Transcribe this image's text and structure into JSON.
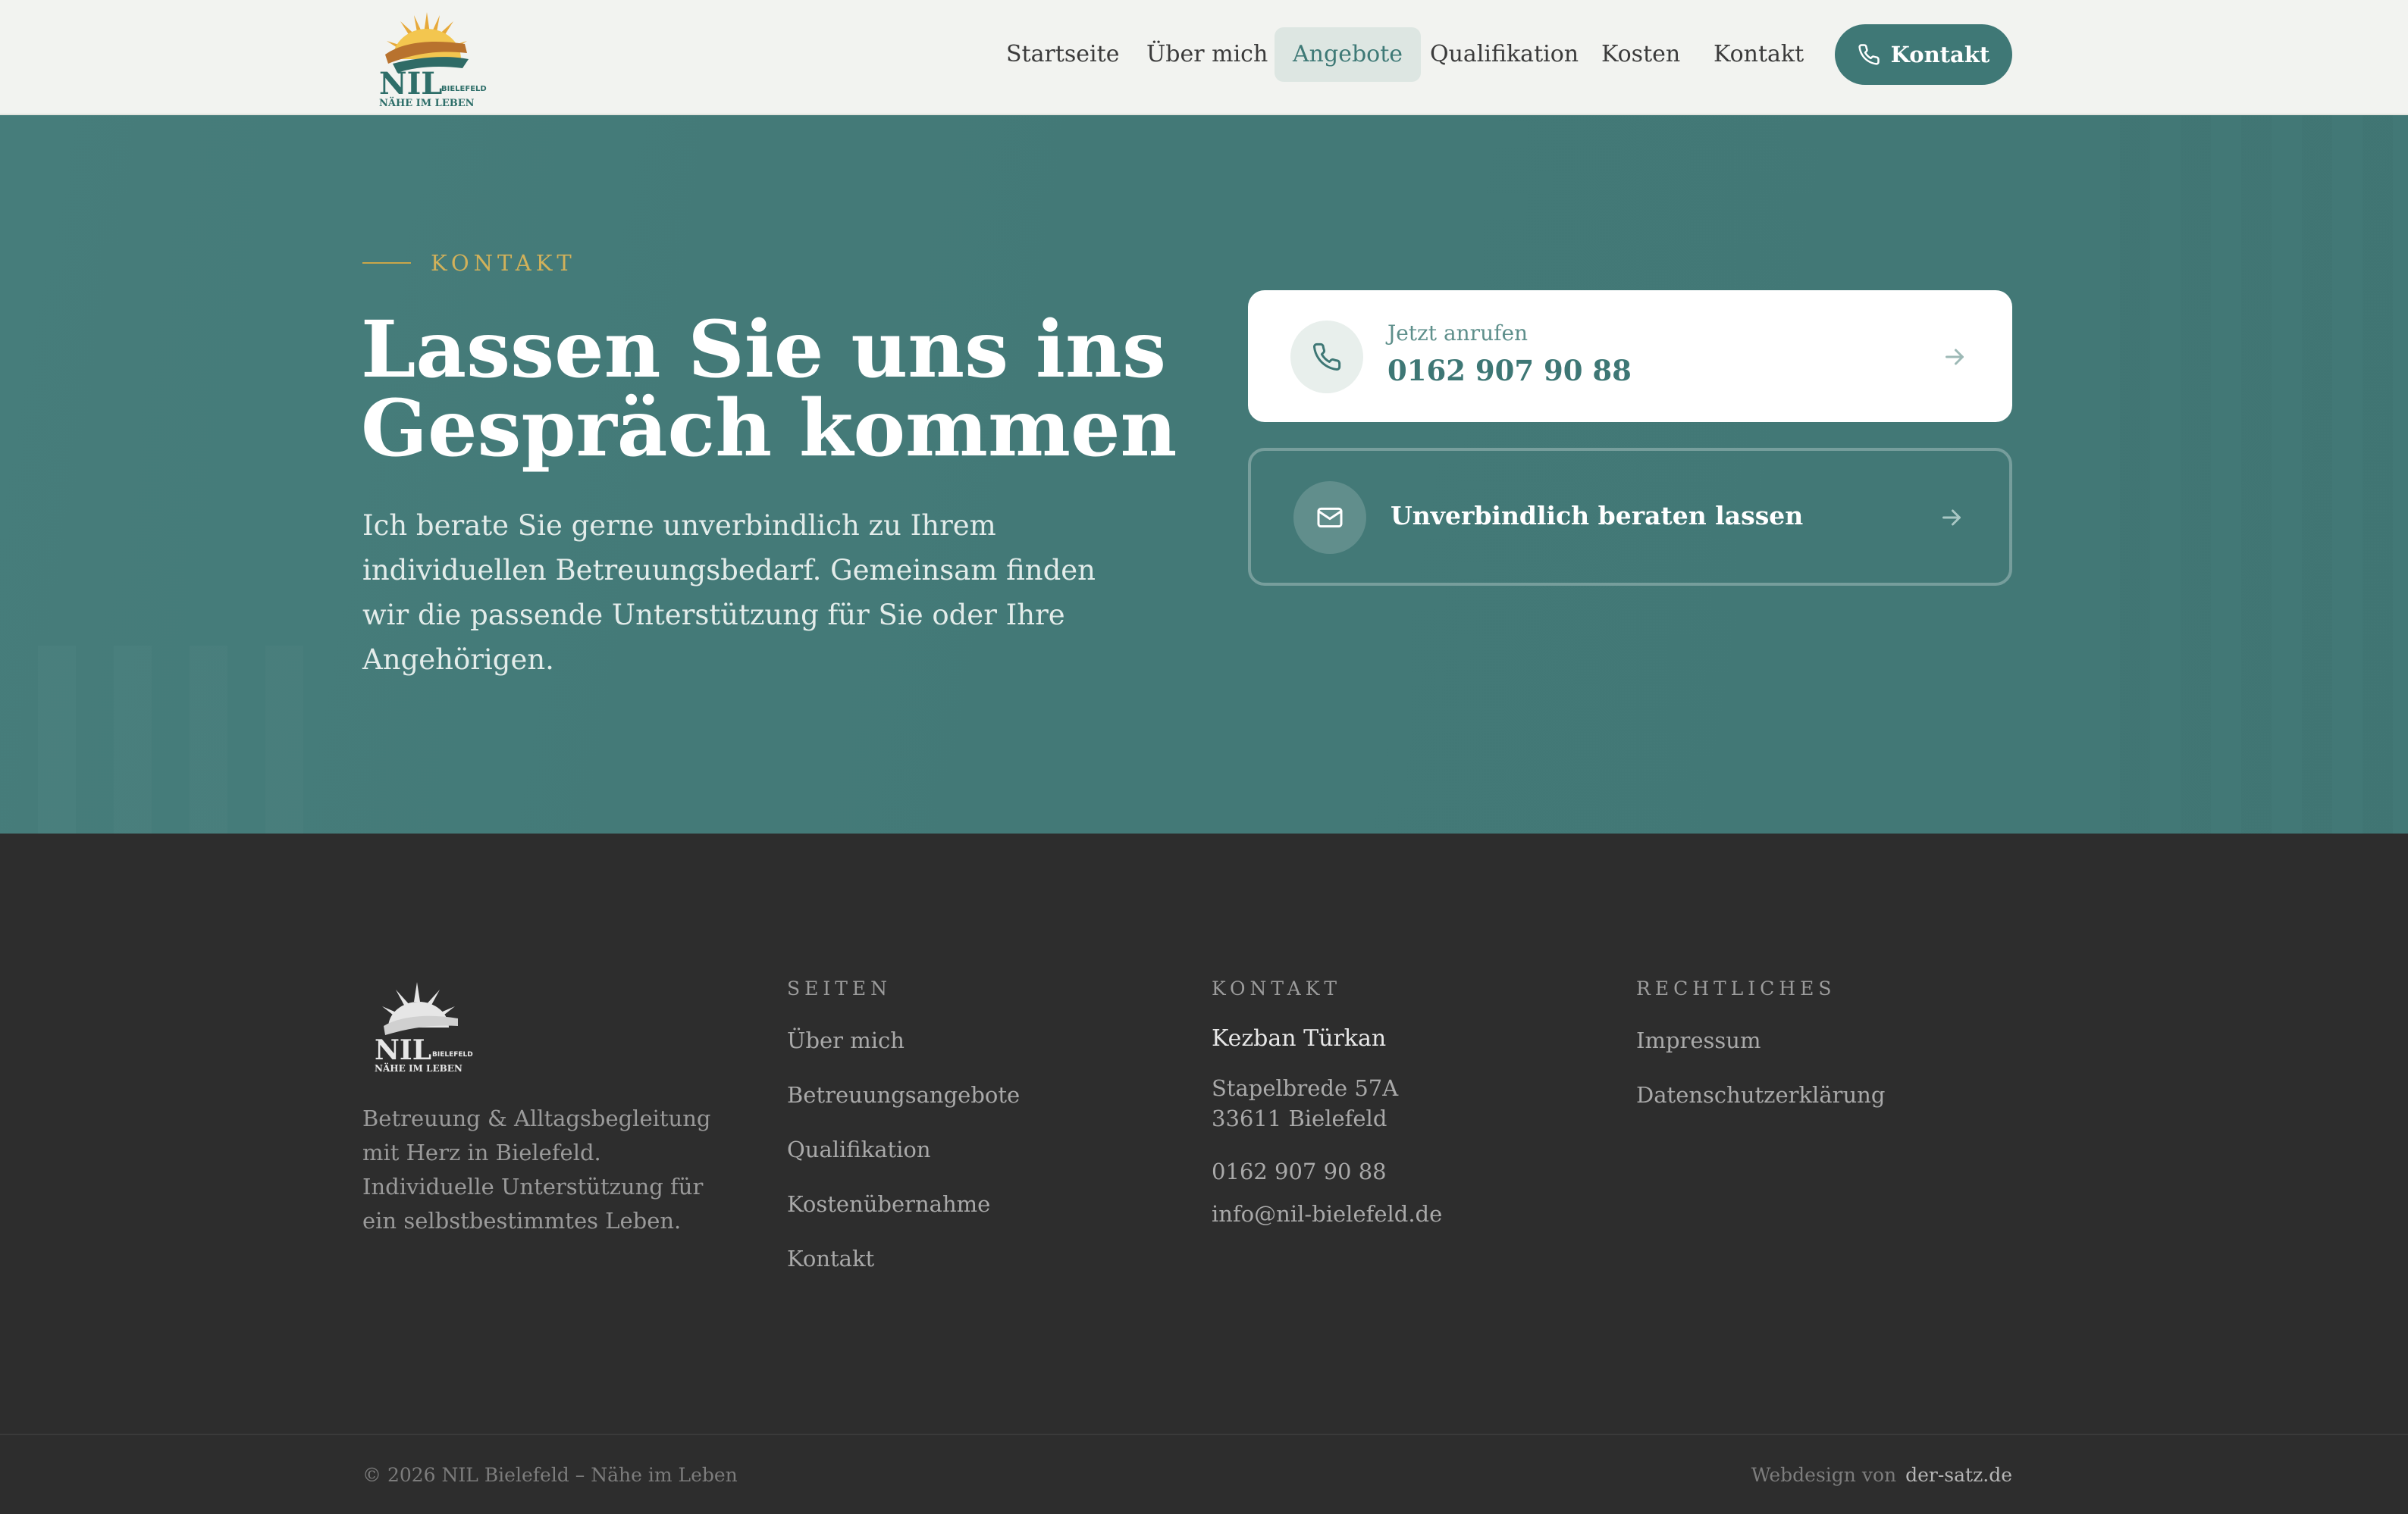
{
  "header": {
    "logo": {
      "name": "NIL",
      "city": "BIELEFELD",
      "tagline": "NÄHE IM LEBEN"
    },
    "nav": [
      {
        "label": "Startseite",
        "active": false
      },
      {
        "label": "Über mich",
        "active": false
      },
      {
        "label": "Angebote",
        "active": true
      },
      {
        "label": "Qualifikation",
        "active": false
      },
      {
        "label": "Kosten",
        "active": false
      },
      {
        "label": "Kontakt",
        "active": false
      }
    ],
    "cta_label": "Kontakt",
    "cta_icon": "phone-icon"
  },
  "hero": {
    "eyebrow": "KONTAKT",
    "title": "Lassen Sie uns ins Gespräch kommen",
    "text": "Ich berate Sie gerne unverbindlich zu Ihrem individuellen Betreuungsbedarf. Gemeinsam finden wir die passende Unterstützung für Sie oder Ihre Angehörigen.",
    "call_card": {
      "label": "Jetzt anrufen",
      "number": "0162 907 90 88",
      "icon": "phone-icon"
    },
    "mail_card": {
      "label": "Unverbindlich beraten lassen",
      "icon": "mail-icon"
    }
  },
  "footer": {
    "logo": {
      "name": "NIL",
      "city": "BIELEFELD",
      "tagline": "NÄHE IM LEBEN"
    },
    "description": "Betreuung & Alltagsbegleitung mit Herz in Bielefeld. Individuelle Unterstützung für ein selbstbestimmtes Leben.",
    "pages": {
      "heading": "SEITEN",
      "links": [
        "Über mich",
        "Betreuungsangebote",
        "Qualifikation",
        "Kostenübernahme",
        "Kontakt"
      ]
    },
    "contact": {
      "heading": "KONTAKT",
      "name": "Kezban Türkan",
      "street": "Stapelbrede 57A",
      "city": "33611 Bielefeld",
      "phone": "0162 907 90 88",
      "email": "info@nil-bielefeld.de"
    },
    "legal": {
      "heading": "RECHTLICHES",
      "links": [
        "Impressum",
        "Datenschutzerklärung"
      ]
    },
    "copyright": "© 2026 NIL Bielefeld – Nähe im Leben",
    "credit_prefix": "Webdesign von",
    "credit_link": "der-satz.de"
  },
  "colors": {
    "primary": "#3f7876",
    "accent": "#c9a64a",
    "footer_bg": "#2d2d2d",
    "header_bg": "#f2f3f0"
  }
}
